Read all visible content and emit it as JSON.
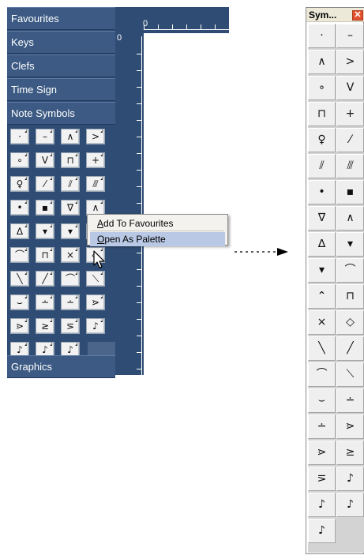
{
  "inspector": {
    "sections_top": [
      "Favourites",
      "Keys",
      "Clefs",
      "Time Sign",
      "Note Symbols"
    ],
    "section_bottom": "Graphics",
    "grid_symbols": [
      [
        "·",
        "–",
        "∧",
        ">"
      ],
      [
        "∘",
        "V",
        "⊓",
        "+"
      ],
      [
        "♀",
        "⁄",
        "⫽",
        "⫻"
      ],
      [
        "•",
        "▪",
        "∇",
        "∧"
      ],
      [
        "∆",
        "▾",
        "▾",
        "⌒"
      ],
      [
        "⌒",
        "⊓",
        "×",
        "◇"
      ],
      [
        "╲",
        "╱",
        "⌒",
        "⟍"
      ],
      [
        "⌣",
        "∸",
        "∸",
        "⋗"
      ],
      [
        "⋗",
        "≥",
        "⋝",
        "♪"
      ],
      [
        "♪",
        "♪",
        "♪",
        ""
      ]
    ]
  },
  "ruler": {
    "top_label": "0",
    "side_label": "0"
  },
  "context_menu": {
    "items": [
      {
        "label": "Add To Favourites",
        "mnemonic": "A"
      },
      {
        "label": "Open As Palette",
        "mnemonic": "O"
      }
    ],
    "highlighted": "Open As Palette"
  },
  "palette": {
    "title": "Sym...",
    "close_glyph": "✕",
    "symbols": [
      [
        "·",
        "–"
      ],
      [
        "∧",
        ">"
      ],
      [
        "∘",
        "V"
      ],
      [
        "⊓",
        "+"
      ],
      [
        "♀",
        "⁄"
      ],
      [
        "⫽",
        "⫻"
      ],
      [
        "•",
        "▪"
      ],
      [
        "∇",
        "∧"
      ],
      [
        "∆",
        "▾"
      ],
      [
        "▾",
        "⌒"
      ],
      [
        "⌃",
        "⊓"
      ],
      [
        "×",
        "◇"
      ],
      [
        "╲",
        "╱"
      ],
      [
        "⌒",
        "⟍"
      ],
      [
        "⌣",
        "∸"
      ],
      [
        "∸",
        "⋗"
      ],
      [
        "⋗",
        "≥"
      ],
      [
        "⋝",
        "♪"
      ],
      [
        "♪",
        "♪"
      ],
      [
        "♪",
        ""
      ]
    ]
  },
  "colors": {
    "panel_bg": "#2f4c74",
    "section_bg": "#3c5a83",
    "menu_highlight": "#b9c8e4",
    "close_button": "#e2512f"
  }
}
